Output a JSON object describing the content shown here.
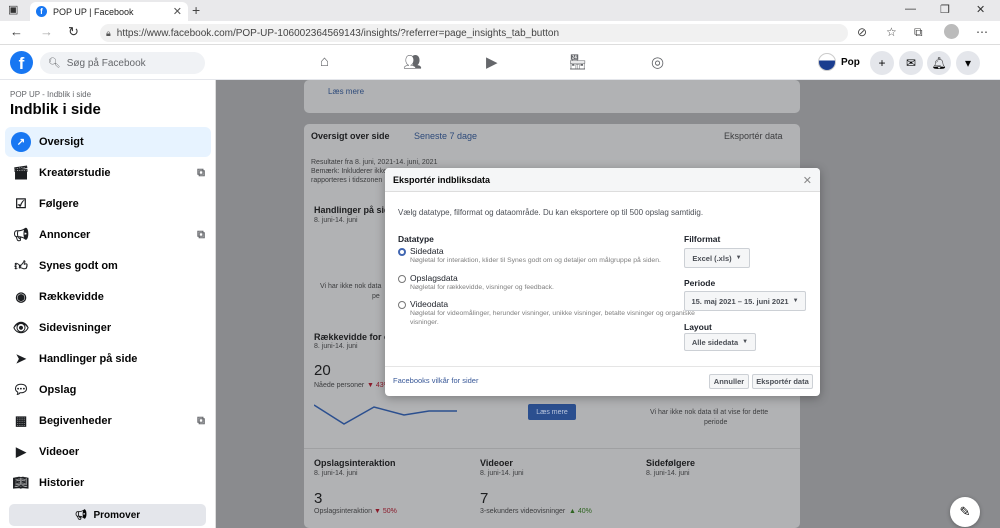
{
  "browser": {
    "tab_title": "POP UP | Facebook",
    "url": "https://www.facebook.com/POP-UP-106002364569143/insights/?referrer=page_insights_tab_button"
  },
  "fb": {
    "search_placeholder": "Søg på Facebook",
    "profile_name": "Pop"
  },
  "sidebar": {
    "breadcrumb": "POP UP - Indblik i side",
    "title": "Indblik i side",
    "items": [
      {
        "label": "Oversigt",
        "icon": "trend-icon"
      },
      {
        "label": "Kreatørstudie",
        "icon": "clapper-icon"
      },
      {
        "label": "Følgere",
        "icon": "check-icon"
      },
      {
        "label": "Annoncer",
        "icon": "megaphone-icon"
      },
      {
        "label": "Synes godt om",
        "icon": "thumbs-up-icon"
      },
      {
        "label": "Rækkevidde",
        "icon": "broadcast-icon"
      },
      {
        "label": "Sidevisninger",
        "icon": "eye-icon"
      },
      {
        "label": "Handlinger på side",
        "icon": "pointer-icon"
      },
      {
        "label": "Opslag",
        "icon": "chat-icon"
      },
      {
        "label": "Begivenheder",
        "icon": "calendar-icon"
      },
      {
        "label": "Videoer",
        "icon": "video-icon"
      },
      {
        "label": "Historier",
        "icon": "book-icon"
      }
    ],
    "promote_label": "Promover"
  },
  "bg": {
    "laes_mere_top": "Læs mere",
    "overview_title": "Oversigt over side",
    "overview_range": "Seneste 7 dage",
    "export_link": "Eksportér data",
    "results_line": "Resultater fra 8. juni, 2021-14. juni, 2021",
    "note_line1": "Bemærk: Inkluderer ikke",
    "note_line2": "rapporteres i tidszonen",
    "handlinger_title": "Handlinger på side",
    "handlinger_date": "8. juni-14. juni",
    "no_data_1": "Vi har ikke nok data",
    "no_data_1b": "pe",
    "rackevidde_title": "Rækkevidde for o",
    "rackevidde_date": "8. juni-14. juni",
    "rackevidde_value": "20",
    "rackevidde_sub": "Nåede personer",
    "rackevidde_change": "43%",
    "laes_mere_btn": "Læs mere",
    "no_data_2a": "Vi har ikke nok data til at vise for dette",
    "no_data_2b": "periode",
    "opslag_title": "Opslagsinteraktion",
    "opslag_date": "8. juni-14. juni",
    "opslag_value": "3",
    "opslag_sub": "Opslagsinteraktion",
    "opslag_change": "50%",
    "videoer_title": "Videoer",
    "videoer_date": "8. juni-14. juni",
    "videoer_value": "7",
    "videoer_sub": "3-sekunders videovisninger",
    "videoer_change": "40%",
    "sidef_title": "Sidefølgere",
    "sidef_date": "8. juni-14. juni"
  },
  "modal": {
    "title": "Eksportér indbliksdata",
    "intro": "Vælg datatype, filformat og dataområde. Du kan eksportere op til 500 opslag samtidig.",
    "datatype_label": "Datatype",
    "options": [
      {
        "title": "Sidedata",
        "desc": "Nøgletal for interaktion, klider til Synes godt om og detaljer om målgruppe på siden.",
        "selected": true
      },
      {
        "title": "Opslagsdata",
        "desc": "Nøgletal for rækkevidde, visninger og feedback.",
        "selected": false
      },
      {
        "title": "Videodata",
        "desc": "Nøgletal for videomålinger, herunder visninger, unikke visninger, betalte visninger og organiske visninger.",
        "selected": false
      }
    ],
    "fileformat_label": "Filformat",
    "fileformat_value": "Excel (.xls)",
    "period_label": "Periode",
    "period_value": "15. maj 2021 – 15. juni 2021",
    "layout_label": "Layout",
    "layout_value": "Alle sidedata",
    "terms_link": "Facebooks vilkår for sider",
    "cancel_label": "Annuller",
    "export_label": "Eksportér data"
  },
  "colors": {
    "accent": "#1877f2",
    "dim": "#8a8b8e",
    "negative": "#e41e3f",
    "positive": "#42b72a"
  }
}
